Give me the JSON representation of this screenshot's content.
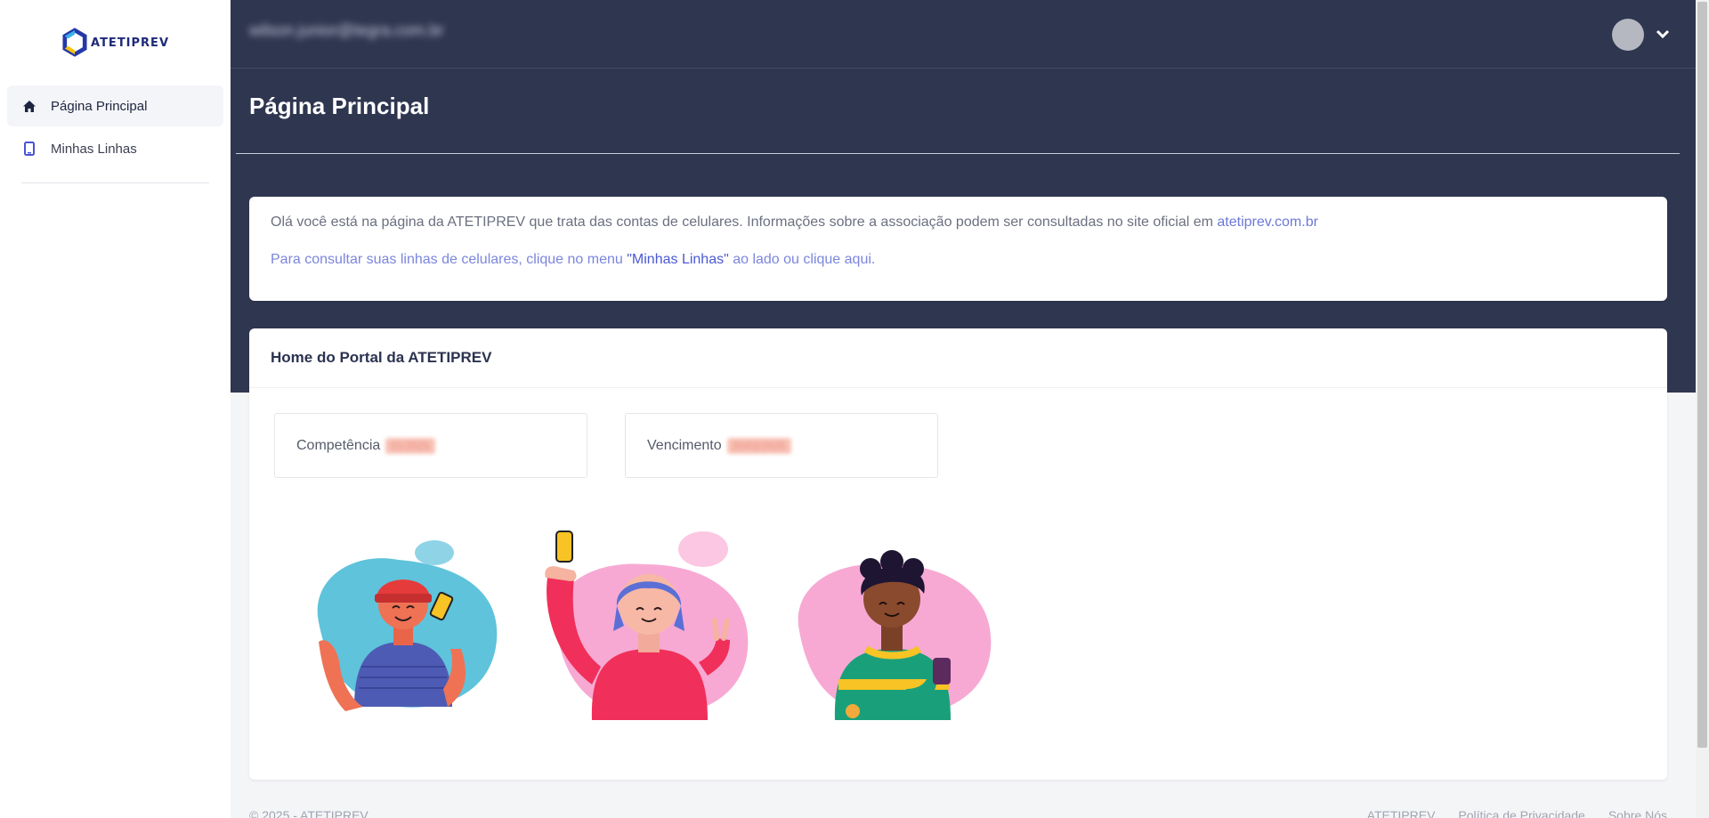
{
  "app": {
    "logo_text": "ATETIPREV",
    "brand_color": "#2f3650"
  },
  "sidebar": {
    "items": [
      {
        "label": "Página Principal",
        "icon": "home-icon",
        "active": true
      },
      {
        "label": "Minhas Linhas",
        "icon": "phone-icon",
        "active": false
      }
    ]
  },
  "header": {
    "user_email": "wilson.junior@tegra.com.br"
  },
  "page": {
    "title": "Página Principal"
  },
  "info": {
    "line1_text": "Olá você está na página da ATETIPREV que trata das contas de celulares. Informações sobre a associação podem ser consultadas no site oficial em ",
    "line1_link": "atetiprev.com.br",
    "line2_prefix": "Para consultar suas linhas de celulares, clique no menu ",
    "line2_highlight": "\"Minhas Linhas\"",
    "line2_suffix": " ao lado ou clique aqui."
  },
  "home": {
    "title": "Home do Portal da ATETIPREV",
    "competencia_label": "Competência",
    "competencia_value": "01/2025",
    "vencimento_label": "Vencimento",
    "vencimento_value": "20/02/2025"
  },
  "footer": {
    "copyright": "© 2025 - ATETIPREV",
    "links": [
      "ATETIPREV",
      "Política de Privacidade",
      "Sobre Nós"
    ]
  }
}
